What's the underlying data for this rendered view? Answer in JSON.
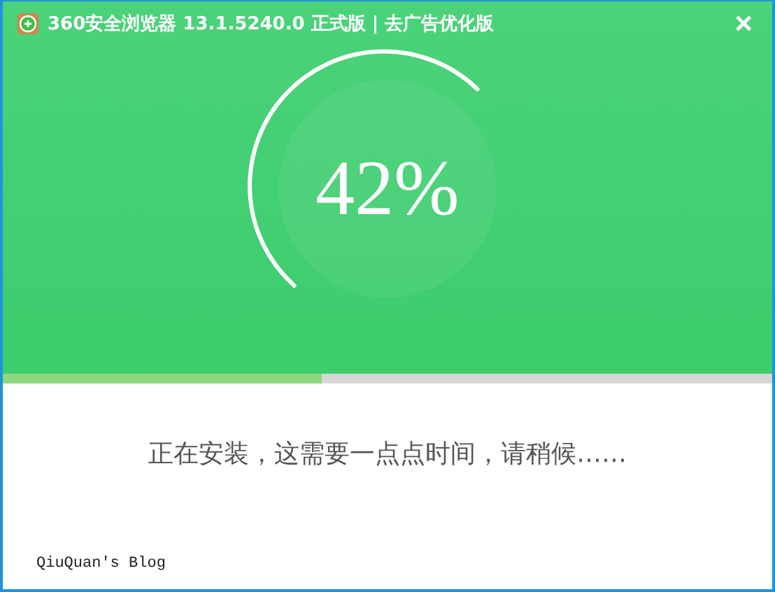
{
  "window": {
    "title": "360安全浏览器 13.1.5240.0 正式版 | 去广告优化版",
    "close": "×"
  },
  "progress": {
    "percent": "42%",
    "level": 0.415
  },
  "status": "正在安装，这需要一点点时间，请稍候……",
  "footer": "QiuQuan's Blog"
}
